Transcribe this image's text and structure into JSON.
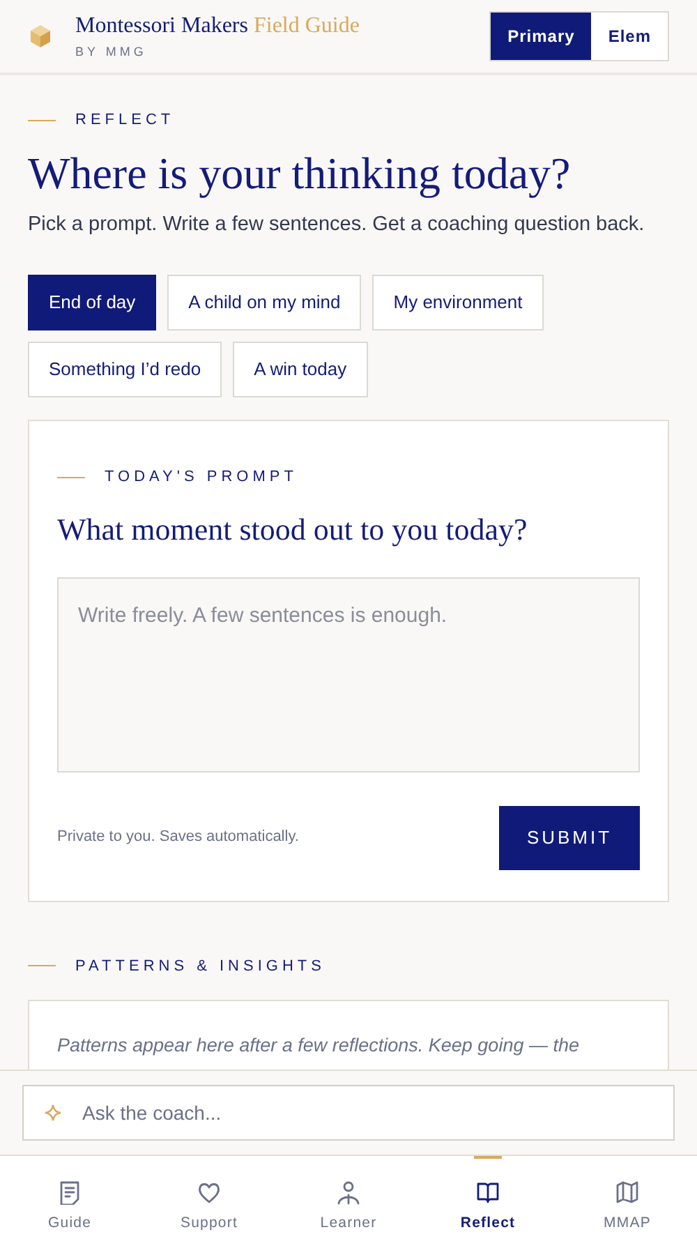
{
  "header": {
    "brand_name": "Montessori Makers",
    "brand_accent": "Field Guide",
    "byline": "BY MMG",
    "levels": [
      {
        "label": "Primary",
        "selected": true
      },
      {
        "label": "Elem",
        "selected": false
      }
    ]
  },
  "eyebrow": "REFLECT",
  "title": "Where is your thinking today?",
  "subtitle": "Pick a prompt. Write a few sentences. Get a coaching question back.",
  "prompts": [
    {
      "label": "End of day",
      "selected": true
    },
    {
      "label": "A child on my mind",
      "selected": false
    },
    {
      "label": "My environment",
      "selected": false
    },
    {
      "label": "Something I’d redo",
      "selected": false
    },
    {
      "label": "A win today",
      "selected": false
    }
  ],
  "prompt_card": {
    "eyebrow": "TODAY'S PROMPT",
    "question": "What moment stood out to you today?",
    "placeholder": "Write freely. A few sentences is enough.",
    "note": "Private to you. Saves automatically.",
    "submit": "SUBMIT"
  },
  "insights": {
    "eyebrow": "PATTERNS & INSIGHTS",
    "text": "Patterns appear here after a few reflections. Keep going — the"
  },
  "coach": {
    "placeholder": "Ask the coach..."
  },
  "nav": [
    {
      "label": "Guide",
      "selected": false
    },
    {
      "label": "Support",
      "selected": false
    },
    {
      "label": "Learner",
      "selected": false
    },
    {
      "label": "Reflect",
      "selected": true
    },
    {
      "label": "MMAP",
      "selected": false
    }
  ]
}
